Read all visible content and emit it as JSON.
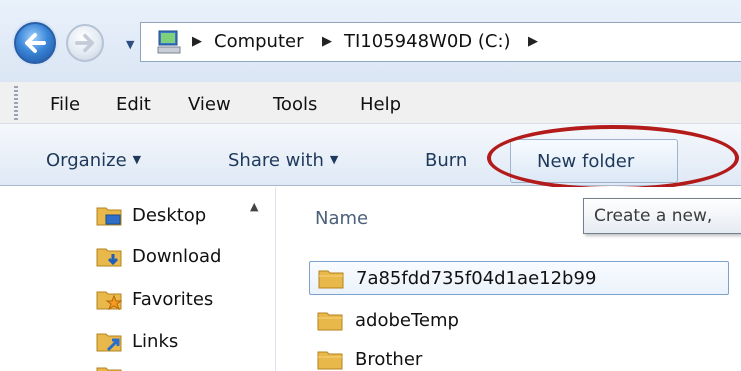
{
  "address": {
    "crumbs": [
      "Computer",
      "TI105948W0D (C:)"
    ]
  },
  "menu": [
    "File",
    "Edit",
    "View",
    "Tools",
    "Help"
  ],
  "command_bar": {
    "organize": "Organize",
    "share_with": "Share with",
    "burn": "Burn",
    "new_folder": "New folder"
  },
  "tooltip": "Create a new,",
  "nav_pane": [
    {
      "label": "Desktop",
      "icon": "desktop-folder-icon"
    },
    {
      "label": "Download",
      "icon": "downloads-folder-icon"
    },
    {
      "label": "Favorites",
      "icon": "favorites-folder-icon"
    },
    {
      "label": "Links",
      "icon": "links-folder-icon"
    }
  ],
  "content": {
    "column_name": "Name",
    "files": [
      "7a85fdd735f04d1ae12b99",
      "adobeTemp",
      "Brother"
    ]
  },
  "colors": {
    "highlight_ellipse": "#b31b1b",
    "command_text": "#1e395b"
  }
}
